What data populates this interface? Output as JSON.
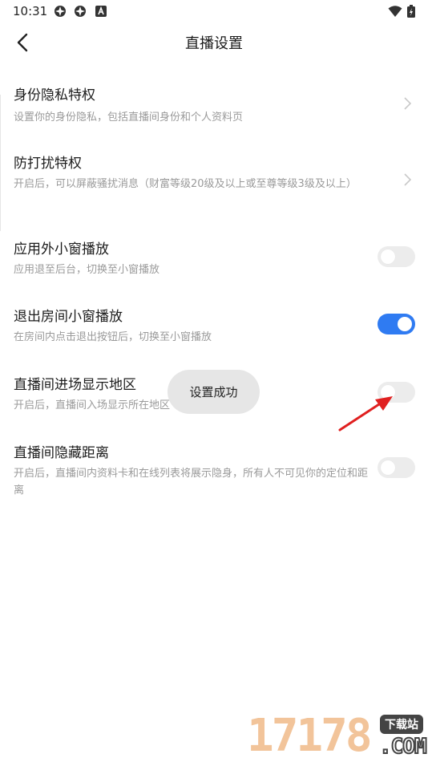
{
  "status_bar": {
    "time": "10:31",
    "icons": [
      "app-notification-icon",
      "app-notification-icon",
      "android-icon",
      "wifi-icon",
      "battery-charging-icon"
    ]
  },
  "header": {
    "back_icon": "chevron-left-icon",
    "title": "直播设置"
  },
  "settings": [
    {
      "title": "身份隐私特权",
      "desc": "设置你的身份隐私，包括直播间身份和个人资料页",
      "control": "chevron"
    },
    {
      "title": "防打扰特权",
      "desc": "开启后，可以屏蔽骚扰消息（财富等级20级及以上或至尊等级3级及以上）",
      "control": "chevron"
    },
    {
      "title": "应用外小窗播放",
      "desc": "应用退至后台，切换至小窗播放",
      "control": "toggle",
      "on": false
    },
    {
      "title": "退出房间小窗播放",
      "desc": "在房间内点击退出按钮后，切换至小窗播放",
      "control": "toggle",
      "on": true
    },
    {
      "title": "直播间进场显示地区",
      "desc": "开启后，直播间入场显示所在地区",
      "control": "toggle",
      "on": false
    },
    {
      "title": "直播间隐藏距离",
      "desc": "开启后，直播间内资料卡和在线列表将展示隐身，所有人不可见你的定位和距离",
      "control": "toggle",
      "on": false
    }
  ],
  "toast": {
    "text": "设置成功"
  },
  "annotation": {
    "arrow_color": "#e02020"
  },
  "watermark": {
    "digits": "17178",
    "badge": "下载站",
    "suffix": ".COM"
  },
  "colors": {
    "toggle_on": "#2f7bf2",
    "toggle_off": "#ececec"
  }
}
